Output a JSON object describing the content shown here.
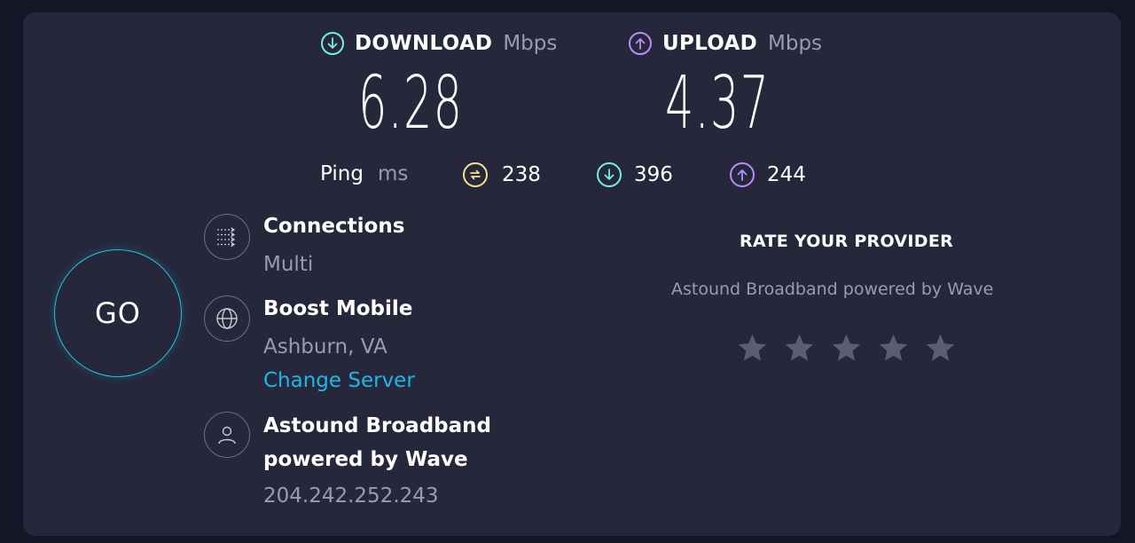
{
  "download": {
    "label": "DOWNLOAD",
    "unit": "Mbps",
    "value": "6.28"
  },
  "upload": {
    "label": "UPLOAD",
    "unit": "Mbps",
    "value": "4.37"
  },
  "ping": {
    "label": "Ping",
    "unit": "ms",
    "idle": "238",
    "download": "396",
    "upload": "244"
  },
  "go_label": "GO",
  "connections": {
    "title": "Connections",
    "value": "Multi"
  },
  "server": {
    "name": "Boost Mobile",
    "location": "Ashburn, VA",
    "change_label": "Change Server"
  },
  "provider": {
    "line1": "Astound Broadband",
    "line2": "powered by Wave",
    "ip": "204.242.252.243"
  },
  "rating": {
    "title": "RATE YOUR PROVIDER",
    "provider_name": "Astound Broadband powered by Wave",
    "stars_total": 5,
    "stars_selected": 0
  },
  "colors": {
    "background": "#141526",
    "panel": "#26273b",
    "download_accent": "#6ff2e5",
    "upload_accent": "#b98cf6",
    "idle_accent": "#f6e28b",
    "go_ring": "#21c5e0",
    "link": "#1ab9e6",
    "star": "#5c5d72"
  }
}
